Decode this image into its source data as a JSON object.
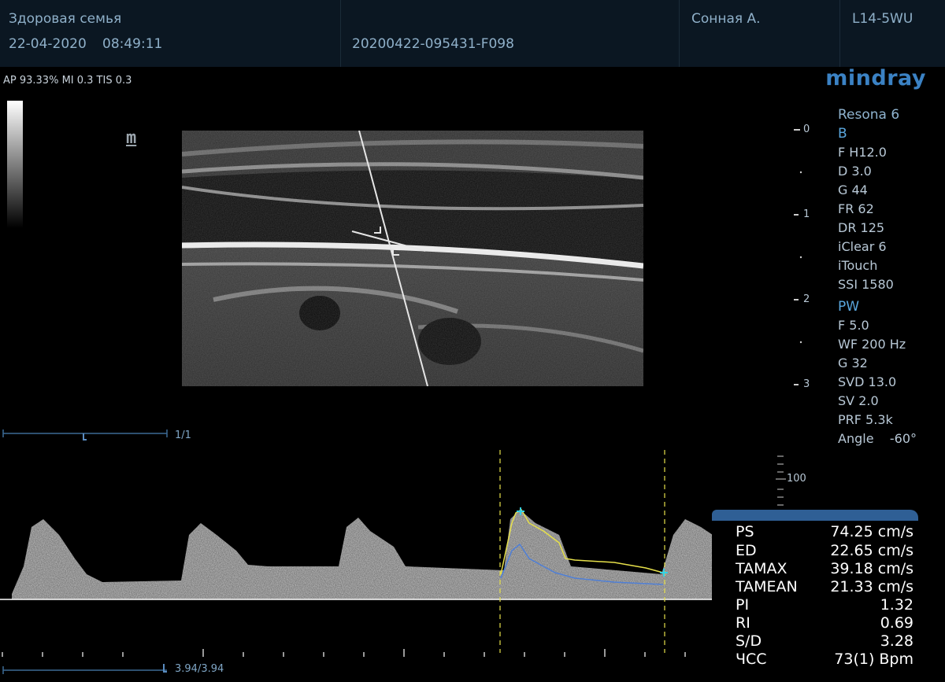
{
  "header": {
    "clinic": "Здоровая семья",
    "date": "22-04-2020",
    "time": "08:49:11",
    "exam_id": "20200422-095431-F098",
    "patient": "Сонная А.",
    "probe": "L14-5WU"
  },
  "safety": "AP 93.33%  MI 0.3 TIS 0.3",
  "brand": {
    "logo": "mindray",
    "model": "Resona 6"
  },
  "bmode_params": {
    "title": "B",
    "items": [
      "F H12.0",
      "D 3.0",
      "G 44",
      "FR 62",
      "DR 125",
      "iClear 6",
      "iTouch",
      "SSI 1580"
    ]
  },
  "pw_params": {
    "title": "PW",
    "items": [
      "F 5.0",
      "WF 200 Hz",
      "G 32",
      "SVD 13.0",
      "SV 2.0",
      "PRF 5.3k",
      "Angle    -60°"
    ]
  },
  "depth_scale": [
    "0",
    "1",
    "2",
    "3"
  ],
  "velocity_scale": "100",
  "frames": {
    "bmode": "1/1",
    "doppler": "3.94/3.94"
  },
  "measurements": [
    {
      "label": "PS",
      "value": "74.25 cm/s"
    },
    {
      "label": "ED",
      "value": "22.65 cm/s"
    },
    {
      "label": "TAMAX",
      "value": "39.18 cm/s"
    },
    {
      "label": "TAMEAN",
      "value": "21.33 cm/s"
    },
    {
      "label": "PI",
      "value": "1.32"
    },
    {
      "label": "RI",
      "value": "0.69"
    },
    {
      "label": "S/D",
      "value": "3.28"
    },
    {
      "label": "ЧСС",
      "value": "73(1) Bpm"
    }
  ],
  "colors": {
    "accent": "#2f5f95",
    "trace_max": "#e6e04a",
    "trace_mean": "#4f7fd6",
    "marker": "#35d2e6"
  }
}
